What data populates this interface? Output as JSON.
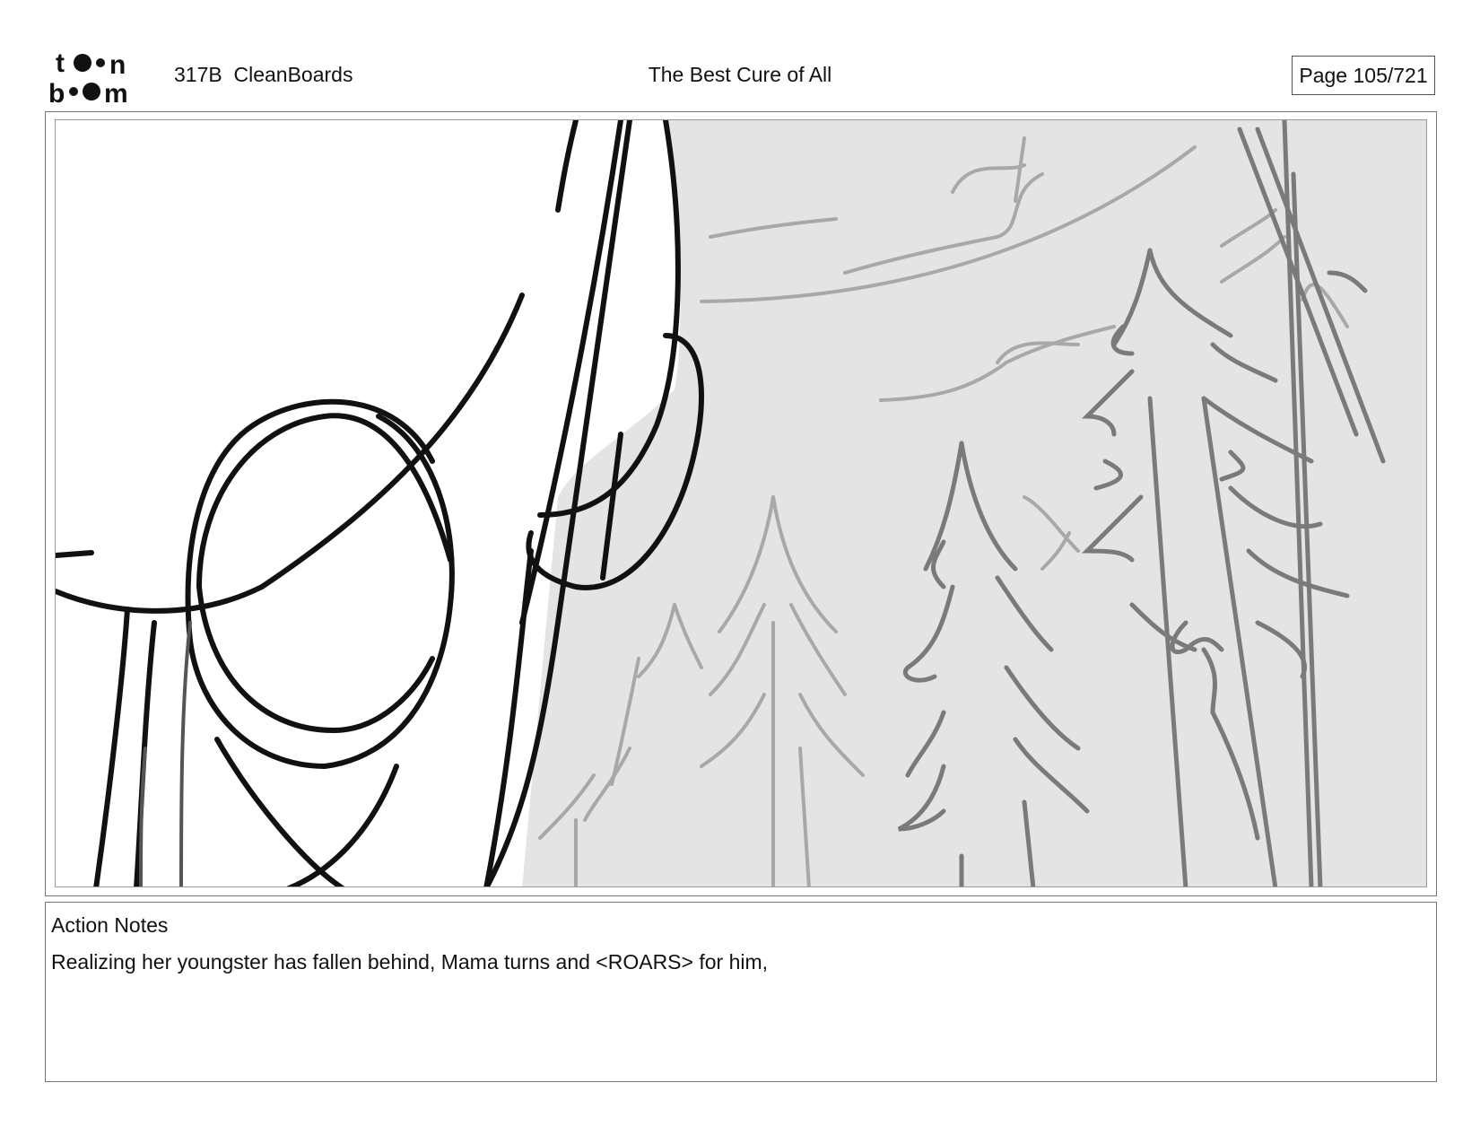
{
  "header": {
    "logo_text": "toon boom",
    "project": "317B  CleanBoards",
    "title": "The Best Cure of All",
    "page": "Page 105/721"
  },
  "panel": {
    "icon": "storyboard-sketch-forest-image"
  },
  "notes": {
    "label": "Action Notes",
    "text": "Realizing her youngster has fallen behind, Mama turns and <ROARS> for him,"
  }
}
